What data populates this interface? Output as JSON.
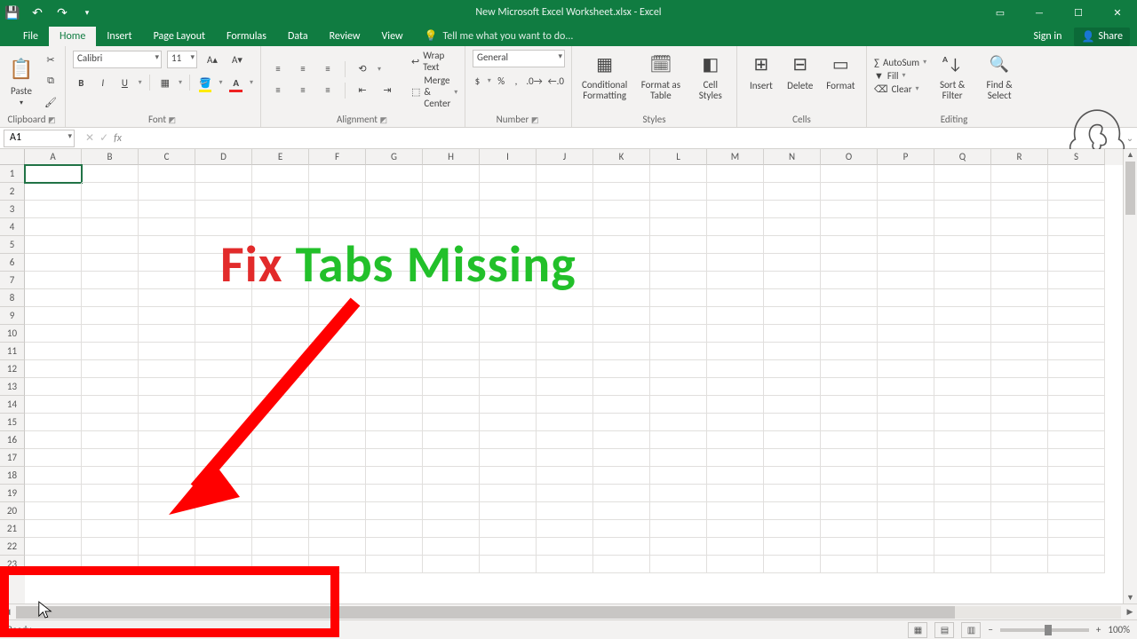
{
  "titlebar": {
    "title": "New Microsoft Excel Worksheet.xlsx - Excel"
  },
  "tabs": {
    "file": "File",
    "home": "Home",
    "insert": "Insert",
    "pagelayout": "Page Layout",
    "formulas": "Formulas",
    "data": "Data",
    "review": "Review",
    "view": "View",
    "tellme": "Tell me what you want to do...",
    "signin": "Sign in",
    "share": "Share"
  },
  "ribbon": {
    "clipboard": {
      "label": "Clipboard",
      "paste": "Paste"
    },
    "font": {
      "label": "Font",
      "name": "Calibri",
      "size": "11",
      "bold": "B",
      "italic": "I",
      "underline": "U"
    },
    "alignment": {
      "label": "Alignment",
      "wrap": "Wrap Text",
      "merge": "Merge & Center"
    },
    "number": {
      "label": "Number",
      "format": "General"
    },
    "styles": {
      "label": "Styles",
      "cond": "Conditional Formatting",
      "table": "Format as Table",
      "cell": "Cell Styles"
    },
    "cells": {
      "label": "Cells",
      "insert": "Insert",
      "delete": "Delete",
      "format": "Format"
    },
    "editing": {
      "label": "Editing",
      "autosum": "AutoSum",
      "fill": "Fill",
      "clear": "Clear",
      "sort": "Sort & Filter",
      "find": "Find & Select"
    }
  },
  "formula": {
    "namebox": "A1",
    "fx": "fx"
  },
  "grid": {
    "cols": [
      "A",
      "B",
      "C",
      "D",
      "E",
      "F",
      "G",
      "H",
      "I",
      "J",
      "K",
      "L",
      "M",
      "N",
      "O",
      "P",
      "Q",
      "R",
      "S"
    ],
    "rows": [
      "1",
      "2",
      "3",
      "4",
      "5",
      "6",
      "7",
      "8",
      "9",
      "10",
      "11",
      "12",
      "13",
      "14",
      "15",
      "16",
      "17",
      "18",
      "19",
      "20",
      "21",
      "22",
      "23"
    ]
  },
  "status": {
    "ready": "Ready",
    "zoom": "100%"
  },
  "overlay": {
    "fix": "Fix",
    "rest": " Tabs Missing"
  }
}
